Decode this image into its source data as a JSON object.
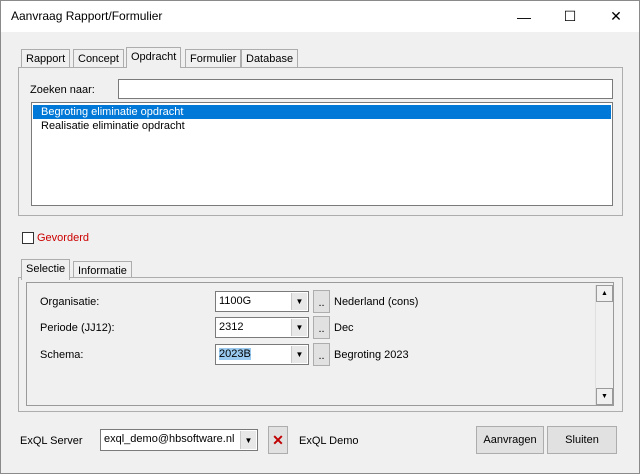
{
  "window": {
    "title": "Aanvraag Rapport/Formulier",
    "controls": {
      "minimize": "—",
      "maximize": "☐",
      "close": "✕"
    }
  },
  "main_tabs": [
    {
      "label": "Rapport"
    },
    {
      "label": "Concept"
    },
    {
      "label": "Opdracht",
      "active": true
    },
    {
      "label": "Formulier"
    },
    {
      "label": "Database"
    }
  ],
  "search": {
    "label": "Zoeken naar:",
    "value": ""
  },
  "list": {
    "items": [
      {
        "label": "Begroting eliminatie opdracht",
        "selected": true
      },
      {
        "label": "Realisatie eliminatie opdracht",
        "selected": false
      }
    ]
  },
  "gevorderd": {
    "label": "Gevorderd",
    "checked": false,
    "color": "#cc0000"
  },
  "sub_tabs": [
    {
      "label": "Selectie",
      "active": true
    },
    {
      "label": "Informatie"
    }
  ],
  "selection": {
    "fields": [
      {
        "label": "Organisatie:",
        "value": "1100G",
        "dots": "..",
        "description": "Nederland (cons)"
      },
      {
        "label": "Periode (JJ12):",
        "value": "2312",
        "dots": "..",
        "description": "Dec"
      },
      {
        "label": "Schema:",
        "value": "2023B",
        "dots": "..",
        "description": "Begroting 2023",
        "highlighted": true
      }
    ]
  },
  "scrollbar": {
    "up": "▲",
    "down": "▼"
  },
  "footer": {
    "server_label": "ExQL Server",
    "server_value": "exql_demo@hbsoftware.nl",
    "clear_glyph": "✕",
    "server_name": "ExQL Demo",
    "request_button": "Aanvragen",
    "close_button": "Sluiten"
  },
  "colors": {
    "selection_blue": "#0078d7",
    "highlight": "#99c9ef",
    "window_bg": "#f0f0f0"
  },
  "icons": {
    "combo_arrow": "chevron-down-icon",
    "clear": "x-icon"
  }
}
